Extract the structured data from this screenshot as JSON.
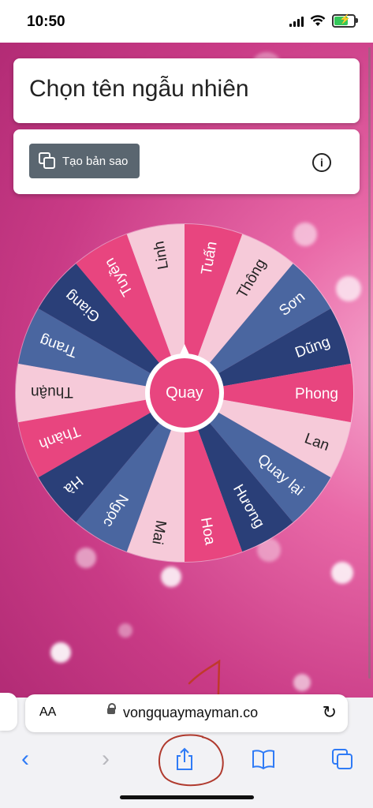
{
  "status": {
    "time": "10:50"
  },
  "page": {
    "title": "Chọn tên ngẫu nhiên",
    "copy_button": "Tạo bản sao",
    "info_icon": "info-icon",
    "spin_button": "Quay"
  },
  "wheel": {
    "segments": [
      {
        "label": "Tuấn",
        "color": "#e8457f",
        "text": "#ffffff"
      },
      {
        "label": "Thông",
        "color": "#f6cad9",
        "text": "#222222"
      },
      {
        "label": "Sơn",
        "color": "#4a66a0",
        "text": "#ffffff"
      },
      {
        "label": "Dũng",
        "color": "#2a3f78",
        "text": "#ffffff"
      },
      {
        "label": "Phong",
        "color": "#e8457f",
        "text": "#ffffff"
      },
      {
        "label": "Lan",
        "color": "#f6cad9",
        "text": "#222222"
      },
      {
        "label": "Quay lại",
        "color": "#4a66a0",
        "text": "#ffffff"
      },
      {
        "label": "Hương",
        "color": "#2a3f78",
        "text": "#ffffff"
      },
      {
        "label": "Hoa",
        "color": "#e8457f",
        "text": "#ffffff"
      },
      {
        "label": "Mai",
        "color": "#f6cad9",
        "text": "#222222"
      },
      {
        "label": "Ngọc",
        "color": "#4a66a0",
        "text": "#ffffff"
      },
      {
        "label": "Hà",
        "color": "#2a3f78",
        "text": "#ffffff"
      },
      {
        "label": "Thành",
        "color": "#e8457f",
        "text": "#ffffff"
      },
      {
        "label": "Thuận",
        "color": "#f6cad9",
        "text": "#222222"
      },
      {
        "label": "Trang",
        "color": "#4a66a0",
        "text": "#ffffff"
      },
      {
        "label": "Giang",
        "color": "#2a3f78",
        "text": "#ffffff"
      },
      {
        "label": "Tuyền",
        "color": "#e8457f",
        "text": "#ffffff"
      },
      {
        "label": "Linh",
        "color": "#f6cad9",
        "text": "#222222"
      }
    ]
  },
  "annotation": {
    "handwritten": "1"
  },
  "safari": {
    "aa": "AA",
    "url": "vongquaymayman.co",
    "toolbar": [
      "back-icon",
      "forward-icon",
      "share-icon",
      "bookmarks-icon",
      "tabs-icon"
    ]
  }
}
